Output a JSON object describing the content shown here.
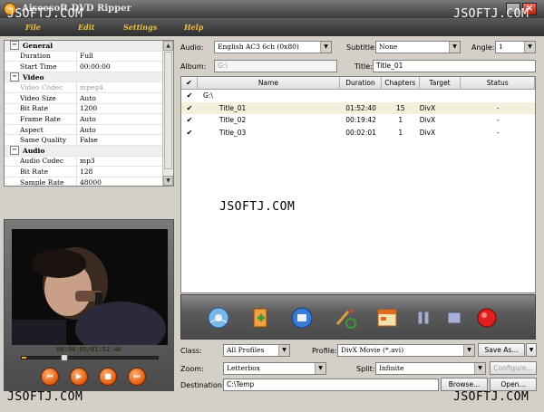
{
  "window": {
    "title": "Aiseesoft DVD Ripper",
    "min_glyph": "_",
    "close_glyph": "×"
  },
  "watermarks": [
    "JSOFTJ.COM",
    "JSOFTJ.COM",
    "JSOFTJ.COM",
    "JSOFTJ.COM",
    "JSOFTJ.COM"
  ],
  "menu": [
    "File",
    "Edit",
    "Settings",
    "Help"
  ],
  "properties": [
    {
      "group": true,
      "label": "General"
    },
    {
      "label": "Duration",
      "value": "Full"
    },
    {
      "label": "Start Time",
      "value": "00:00:00"
    },
    {
      "group": true,
      "label": "Video"
    },
    {
      "label": "Video Codec",
      "value": "mpeg4",
      "disabled": true
    },
    {
      "label": "Video Size",
      "value": "Auto"
    },
    {
      "label": "Bit Rate",
      "value": "1200"
    },
    {
      "label": "Frame Rate",
      "value": "Auto"
    },
    {
      "label": "Aspect",
      "value": "Auto"
    },
    {
      "label": "Same Quality",
      "value": "False"
    },
    {
      "group": true,
      "label": "Audio"
    },
    {
      "label": "Audio Codec",
      "value": "mp3"
    },
    {
      "label": "Bit Rate",
      "value": "128"
    },
    {
      "label": "Sample Rate",
      "value": "48000"
    }
  ],
  "preview": {
    "time": "00:04:05/01:52:40",
    "progress": 0.036
  },
  "options": {
    "audio_label": "Audio:",
    "audio_value": "English AC3 6ch (0x80)",
    "subtitle_label": "Subtitle:",
    "subtitle_value": "None",
    "angle_label": "Angle:",
    "angle_value": "1",
    "album_label": "Album:",
    "album_value": "G:\\",
    "title_label": "Title:",
    "title_value": "Title_01"
  },
  "table": {
    "headers": [
      "Name",
      "Duration",
      "Chapters",
      "Target",
      "Status"
    ],
    "root": "G:\\",
    "rows": [
      {
        "name": "Title_01",
        "duration": "01:52:40",
        "chapters": "15",
        "target": "DivX",
        "status": "-",
        "selected": true
      },
      {
        "name": "Title_02",
        "duration": "00:19:42",
        "chapters": "1",
        "target": "DivX",
        "status": "-"
      },
      {
        "name": "Title_03",
        "duration": "00:02:01",
        "chapters": "1",
        "target": "DivX",
        "status": "-"
      }
    ]
  },
  "bottom": {
    "class_label": "Class:",
    "class_value": "All Profiles",
    "profile_label": "Profile:",
    "profile_value": "DivX Movie  (*.avi)",
    "save_as": "Save As...",
    "zoom_label": "Zoom:",
    "zoom_value": "Letterbox",
    "split_label": "Split:",
    "split_value": "Infinite",
    "configure": "Configure...",
    "destination_label": "Destination:",
    "destination_value": "C:\\Temp",
    "browse": "Browse...",
    "open": "Open..."
  },
  "colors": {
    "selected_row": "#f4f0dc",
    "menu_text": "#f0c040",
    "control_orange": "#e05a10"
  }
}
